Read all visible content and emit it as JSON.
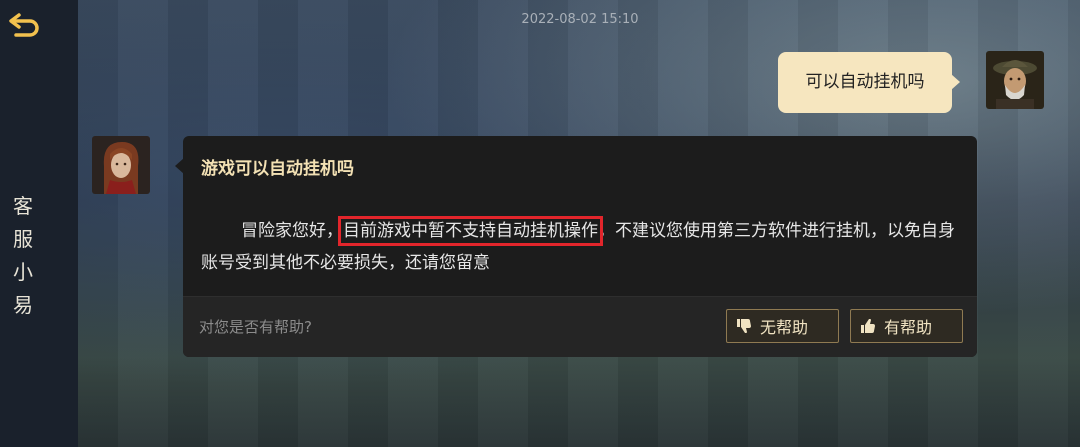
{
  "sidebar": {
    "title": "客服小易",
    "back_icon": "back-arrow-icon"
  },
  "chat": {
    "timestamp": "2022-08-02 15:10",
    "user_message": "可以自动挂机吗",
    "reply": {
      "title": "游戏可以自动挂机吗",
      "body_prefix": "冒险家您好，",
      "body_highlight": "目前游戏中暂不支持自动挂机操作",
      "body_suffix": "，不建议您使用第三方软件进行挂机，以免自身账号受到其他不必要损失，还请您留意",
      "feedback_question": "对您是否有帮助?",
      "not_helpful_label": "无帮助",
      "helpful_label": "有帮助"
    }
  },
  "colors": {
    "accent": "#f6e6bf",
    "highlight_border": "#e2252b",
    "card_bg": "#1c1c1c",
    "title_gold": "#f3e1b4"
  }
}
